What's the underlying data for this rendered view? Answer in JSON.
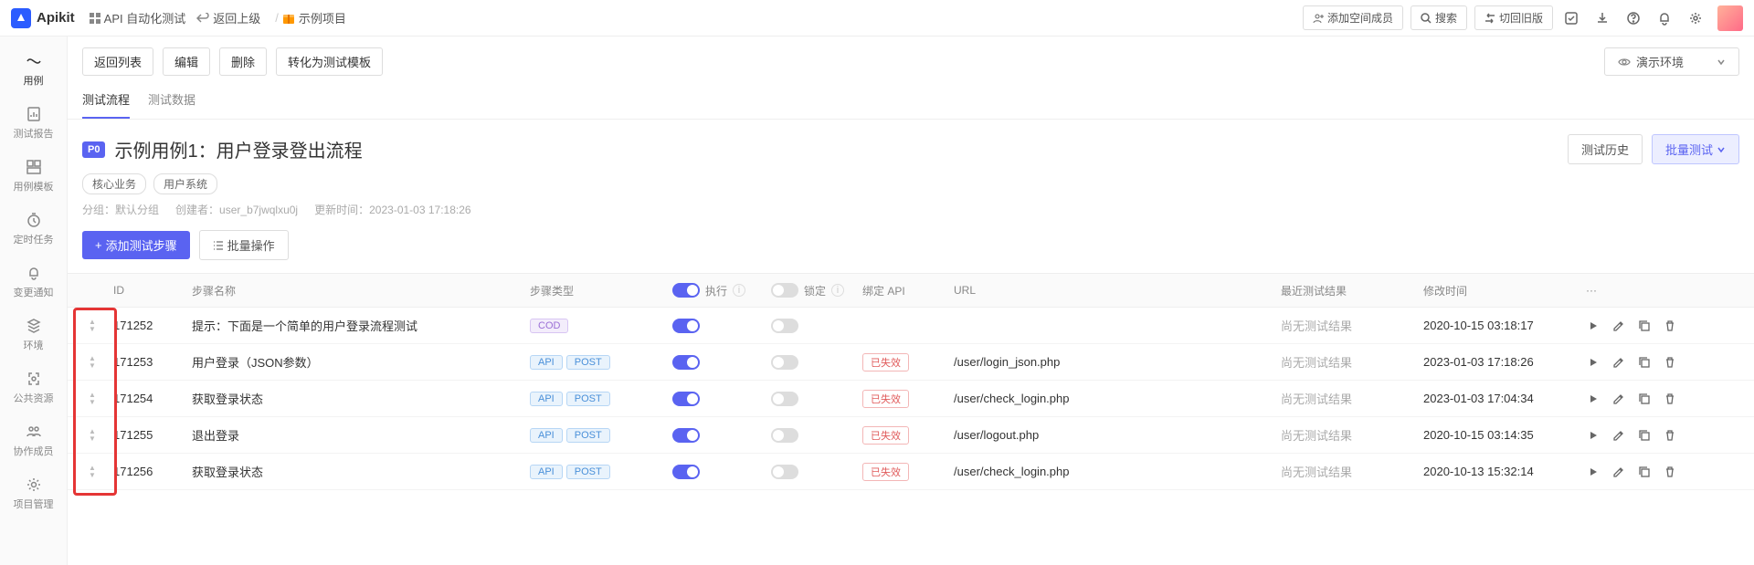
{
  "brand": "Apikit",
  "breadcrumbs": {
    "module_icon": "grid-icon",
    "module": "API 自动化测试",
    "back": "返回上级",
    "project": "示例项目"
  },
  "topbar": {
    "add_member": "添加空间成员",
    "search": "搜索",
    "switch_old": "切回旧版"
  },
  "sidebar": [
    {
      "icon": "case-icon",
      "label": "用例",
      "active": true
    },
    {
      "icon": "report-icon",
      "label": "测试报告"
    },
    {
      "icon": "template-icon",
      "label": "用例模板"
    },
    {
      "icon": "timer-icon",
      "label": "定时任务"
    },
    {
      "icon": "bell-icon",
      "label": "变更通知"
    },
    {
      "icon": "env-icon",
      "label": "环境"
    },
    {
      "icon": "resource-icon",
      "label": "公共资源"
    },
    {
      "icon": "collab-icon",
      "label": "协作成员"
    },
    {
      "icon": "settings-icon",
      "label": "项目管理"
    }
  ],
  "actions": {
    "back_list": "返回列表",
    "edit": "编辑",
    "delete": "删除",
    "to_template": "转化为测试模板"
  },
  "env_selector": {
    "label": "演示环境"
  },
  "tabs": [
    {
      "label": "测试流程",
      "active": true
    },
    {
      "label": "测试数据",
      "active": false
    }
  ],
  "header": {
    "priority": "P0",
    "title": "示例用例1：用户登录登出流程",
    "history_btn": "测试历史",
    "batch_test_btn": "批量测试"
  },
  "tags": [
    "核心业务",
    "用户系统"
  ],
  "meta": {
    "group_label": "分组：",
    "group": "默认分组",
    "creator_label": "创建者：",
    "creator": "user_b7jwqlxu0j",
    "update_label": "更新时间：",
    "update_time": "2023-01-03 17:18:26"
  },
  "ops": {
    "add_step": "添加测试步骤",
    "batch_ops": "批量操作"
  },
  "table": {
    "columns": {
      "id": "ID",
      "name": "步骤名称",
      "type": "步骤类型",
      "exec": "执行",
      "lock": "锁定",
      "bind": "绑定 API",
      "url": "URL",
      "result": "最近测试结果",
      "mtime": "修改时间",
      "more": "···"
    },
    "result_none": "尚无测试结果",
    "badges": {
      "cod": "COD",
      "api": "API",
      "post": "POST",
      "invalid": "已失效"
    },
    "rows": [
      {
        "id": "171252",
        "name": "提示：下面是一个简单的用户登录流程测试",
        "type": "cod",
        "exec": true,
        "lock": false,
        "bind": "",
        "url": "",
        "mtime": "2020-10-15 03:18:17"
      },
      {
        "id": "171253",
        "name": "用户登录（JSON参数）",
        "type": "api",
        "exec": true,
        "lock": false,
        "bind": "invalid",
        "url": "/user/login_json.php",
        "mtime": "2023-01-03 17:18:26"
      },
      {
        "id": "171254",
        "name": "获取登录状态",
        "type": "api",
        "exec": true,
        "lock": false,
        "bind": "invalid",
        "url": "/user/check_login.php",
        "mtime": "2023-01-03 17:04:34"
      },
      {
        "id": "171255",
        "name": "退出登录",
        "type": "api",
        "exec": true,
        "lock": false,
        "bind": "invalid",
        "url": "/user/logout.php",
        "mtime": "2020-10-15 03:14:35"
      },
      {
        "id": "171256",
        "name": "获取登录状态",
        "type": "api",
        "exec": true,
        "lock": false,
        "bind": "invalid",
        "url": "/user/check_login.php",
        "mtime": "2020-10-13 15:32:14"
      }
    ]
  }
}
